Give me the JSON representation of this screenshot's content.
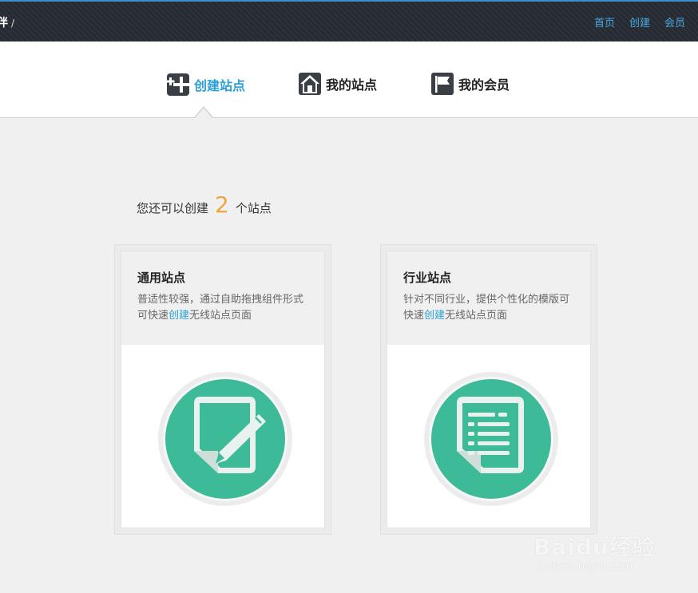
{
  "topbar": {
    "breadcrumb": "伴",
    "breadcrumb_sep": "/",
    "nav": [
      "首页",
      "创建",
      "会员"
    ]
  },
  "tabs": [
    {
      "label": "创建站点",
      "icon": "plus-grid-icon",
      "active": true
    },
    {
      "label": "我的站点",
      "icon": "home-icon",
      "active": false
    },
    {
      "label": "我的会员",
      "icon": "flag-icon",
      "active": false
    }
  ],
  "remaining": {
    "prefix": "您还可以创建",
    "count": "2",
    "suffix": "个站点"
  },
  "cards": [
    {
      "title": "通用站点",
      "desc_part1": "普适性较强，通过自助拖拽组件形式可快速",
      "desc_link": "创建",
      "desc_part2": "无线站点页面",
      "icon": "edit-document-icon"
    },
    {
      "title": "行业站点",
      "desc_part1": "针对不同行业，提供个性化的模版可快速",
      "desc_link": "创建",
      "desc_part2": "无线站点页面",
      "icon": "list-document-icon"
    }
  ],
  "watermark": {
    "logo": "Baidu经验",
    "url": "jingyan.baidu.com"
  },
  "colors": {
    "accent": "#2a9fd6",
    "count": "#f0a43c",
    "badge": "#3dbb98",
    "topbar": "#262b33"
  }
}
